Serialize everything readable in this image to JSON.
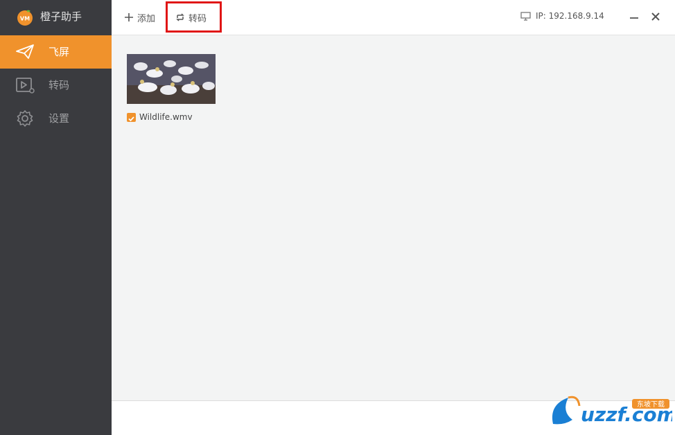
{
  "app": {
    "name": "橙子助手",
    "logo_text": "VM"
  },
  "sidebar": {
    "items": [
      {
        "label": "飞屏",
        "icon": "paper-plane-icon",
        "active": true
      },
      {
        "label": "转码",
        "icon": "video-play-icon",
        "active": false
      },
      {
        "label": "设置",
        "icon": "gear-icon",
        "active": false
      }
    ]
  },
  "toolbar": {
    "add_label": "添加",
    "convert_label": "转码",
    "ip_text": "IP: 192.168.9.14"
  },
  "files": [
    {
      "name": "Wildlife.wmv",
      "checked": true
    }
  ],
  "watermark": {
    "text": "uzzf.com",
    "badge": "东坡下载"
  },
  "colors": {
    "accent": "#f0922c",
    "sidebar_bg": "#3a3b3f",
    "highlight": "#e01515"
  }
}
